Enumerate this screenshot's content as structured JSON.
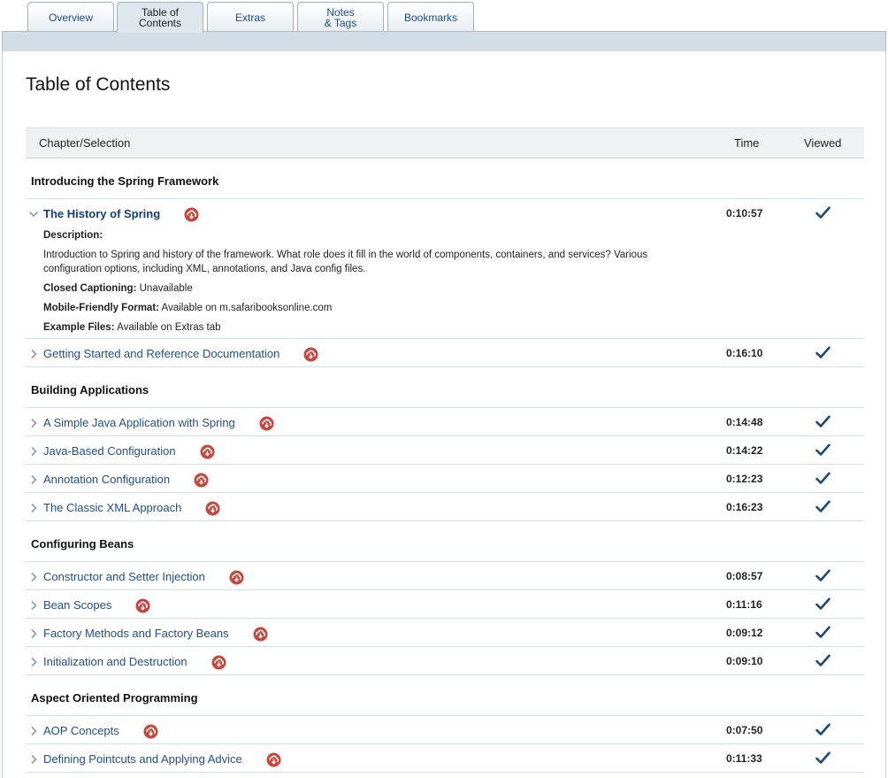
{
  "tabs": [
    {
      "label": "Overview"
    },
    {
      "label": "Table of\nContents"
    },
    {
      "label": "Extras"
    },
    {
      "label": "Notes\n& Tags"
    },
    {
      "label": "Bookmarks"
    }
  ],
  "page": {
    "title": "Table of Contents"
  },
  "table": {
    "headers": {
      "chapter": "Chapter/Selection",
      "time": "Time",
      "viewed": "Viewed"
    }
  },
  "sections": [
    {
      "title": "Introducing the Spring Framework",
      "items": [
        {
          "title": "The History of Spring",
          "time": "0:10:57",
          "viewed": true,
          "expanded": true
        },
        {
          "title": "Getting Started and Reference Documentation",
          "time": "0:16:10",
          "viewed": true
        }
      ]
    },
    {
      "title": "Building Applications",
      "items": [
        {
          "title": "A Simple Java Application with Spring",
          "time": "0:14:48",
          "viewed": true
        },
        {
          "title": "Java-Based Configuration",
          "time": "0:14:22",
          "viewed": true
        },
        {
          "title": "Annotation Configuration",
          "time": "0:12:23",
          "viewed": true
        },
        {
          "title": "The Classic XML Approach",
          "time": "0:16:23",
          "viewed": true
        }
      ]
    },
    {
      "title": "Configuring Beans",
      "items": [
        {
          "title": "Constructor and Setter Injection",
          "time": "0:08:57",
          "viewed": true
        },
        {
          "title": "Bean Scopes",
          "time": "0:11:16",
          "viewed": true
        },
        {
          "title": "Factory Methods and Factory Beans",
          "time": "0:09:12",
          "viewed": true
        },
        {
          "title": "Initialization and Destruction",
          "time": "0:09:10",
          "viewed": true
        }
      ]
    },
    {
      "title": "Aspect Oriented Programming",
      "items": [
        {
          "title": "AOP Concepts",
          "time": "0:07:50",
          "viewed": true
        },
        {
          "title": "Defining Pointcuts and Applying Advice",
          "time": "0:11:33",
          "viewed": true
        }
      ]
    }
  ],
  "details": {
    "description_label": "Description:",
    "description_text": "Introduction to Spring and history of the framework. What role does it fill in the world of components, containers, and services? Various configuration options, including XML, annotations, and Java config files.",
    "cc_label": "Closed Captioning:",
    "cc_value": "Unavailable",
    "mobile_label": "Mobile-Friendly Format:",
    "mobile_value": "Available on m.safaribooksonline.com",
    "files_label": "Example Files:",
    "files_value": "Available on Extras tab"
  },
  "icons": {
    "chevron": "chevron-icon",
    "download": "download-icon",
    "viewed": "check-icon"
  },
  "colors": {
    "link": "#1c4f8d",
    "download": "#c9463d",
    "check": "#1a4a7c",
    "header_bg": "#eef2f5",
    "banner": "#d3dde5"
  }
}
